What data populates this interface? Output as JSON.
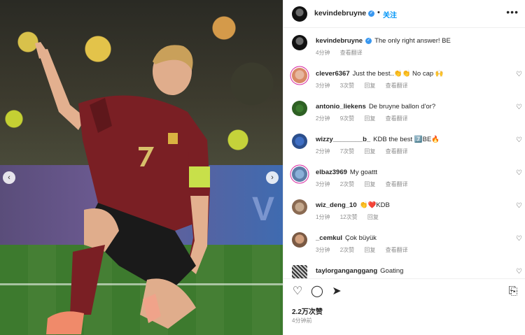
{
  "post": {
    "nav_prev": "‹",
    "nav_next": "›",
    "banner_text": "V"
  },
  "header": {
    "username": "kevindebruyne",
    "verified_mark": "✓",
    "separator": "•",
    "follow_label": "关注",
    "more_label": "•••"
  },
  "caption": {
    "username": "kevindebruyne",
    "verified_mark": "✓",
    "text": "The only right answer! BE",
    "time": "4分钟",
    "translate": "查看翻译"
  },
  "comments": [
    {
      "username": "clever6367",
      "text": "Just the best..👏👏 No cap 🙌",
      "time": "3分钟",
      "likes": "3次赞",
      "reply": "回复",
      "translate": "查看翻译"
    },
    {
      "username": "antonio_liekens",
      "text": "De bruyne ballon d'or?",
      "time": "2分钟",
      "likes": "9次赞",
      "reply": "回复",
      "translate": "查看翻译"
    },
    {
      "username": "wizzy________b_",
      "text": "KDB the best 7️⃣BE🔥",
      "time": "2分钟",
      "likes": "7次赞",
      "reply": "回复",
      "translate": "查看翻译"
    },
    {
      "username": "elbaz3969",
      "text": "My goattt",
      "time": "3分钟",
      "likes": "2次赞",
      "reply": "回复",
      "translate": "查看翻译"
    },
    {
      "username": "wiz_deng_10",
      "text": "👏❤️KDB",
      "time": "1分钟",
      "likes": "12次赞",
      "reply": "回复",
      "translate": ""
    },
    {
      "username": "_cemkul",
      "text": "Çok büyük",
      "time": "3分钟",
      "likes": "2次赞",
      "reply": "回复",
      "translate": "查看翻译"
    },
    {
      "username": "taylorganganggang",
      "text": "Goating",
      "time": "",
      "likes": "",
      "reply": "",
      "translate": ""
    }
  ],
  "actions": {
    "like_icon": "♡",
    "comment_icon": "◯",
    "share_icon": "➤",
    "save_icon": "⎘",
    "comment_heart": "♡",
    "likes_count": "2.2万次赞",
    "posted_time": "4分钟前"
  },
  "colors": {
    "accent": "#0095f6",
    "verified": "#3897f0",
    "jersey": "#7a1f24",
    "armband": "#c8e04a"
  }
}
